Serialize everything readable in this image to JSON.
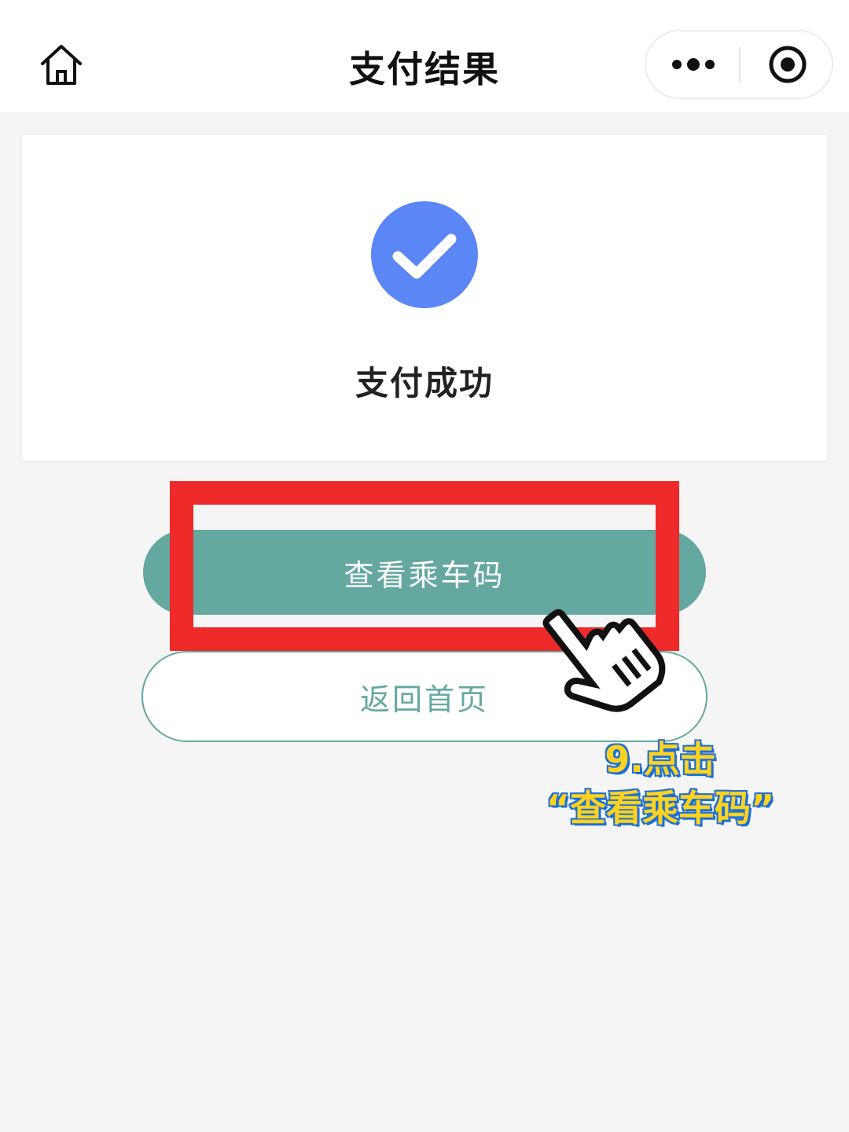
{
  "navbar": {
    "title": "支付结果",
    "icons": {
      "home": "home-icon",
      "more": "more-dots-icon",
      "close": "target-circle-icon"
    }
  },
  "result": {
    "icon": "check-circle-icon",
    "status": "支付成功",
    "accent_color": "#5b86f5"
  },
  "actions": {
    "primary_label": "查看乘车码",
    "secondary_label": "返回首页",
    "theme_color": "#64a8a0"
  },
  "annotation": {
    "step": "9.点击",
    "target": "“查看乘车码”",
    "highlight_color": "#ee2a2a",
    "pointer_icon": "pointing-hand-icon"
  }
}
